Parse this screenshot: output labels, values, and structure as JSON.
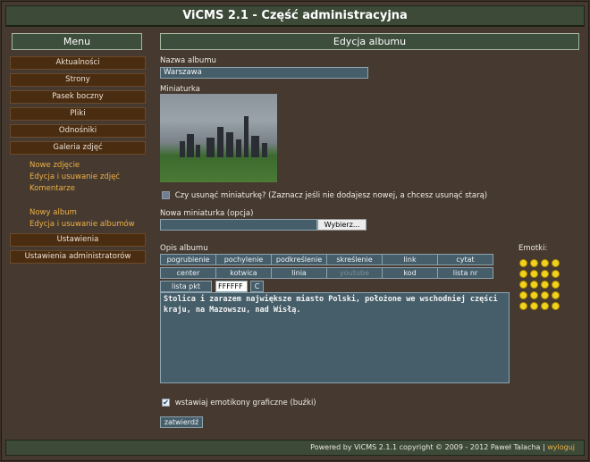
{
  "header": {
    "title": "ViCMS 2.1 - Część administracyjna"
  },
  "sidebar": {
    "title": "Menu",
    "top_items": [
      "Aktualności",
      "Strony",
      "Pasek boczny",
      "Pliki",
      "Odnośniki",
      "Galeria zdjęć"
    ],
    "gallery_links": [
      "Nowe zdjęcie",
      "Edycja i usuwanie zdjęć",
      "Komentarze"
    ],
    "album_links": [
      "Nowy album",
      "Edycja i usuwanie albumów"
    ],
    "bottom_items": [
      "Ustawienia",
      "Ustawienia administratorów"
    ]
  },
  "main": {
    "title": "Edycja albumu",
    "album_name_label": "Nazwa albumu",
    "album_name_value": "Warszawa",
    "thumbnail_label": "Miniaturka",
    "delete_thumb_label": "Czy usunąć miniaturkę? (Zaznacz jeśli nie dodajesz nowej, a chcesz usunąć starą)",
    "new_thumb_label": "Nowa miniaturka (opcja)",
    "browse_label": "Wybierz...",
    "description_label": "Opis albumu",
    "toolbar": {
      "row1": [
        "pogrubienie",
        "pochylenie",
        "podkreślenie",
        "skreślenie",
        "link",
        "cytat"
      ],
      "row2": [
        "center",
        "kotwica",
        "linia",
        "youtube",
        "kod",
        "lista nr"
      ],
      "list_label": "lista pkt",
      "color_value": "FFFFFF",
      "color_button": "C"
    },
    "description_text": "Stolica i zarazem największe miasto Polski, położone we wschodniej części kraju, na Mazowszu, nad Wisłą.",
    "emoticons_label": "Emotki:",
    "insert_emoticons_label": "wstawiaj emotikony graficzne (buźki)",
    "submit_label": "zatwierdź"
  },
  "footer": {
    "text": "Powered by ViCMS 2.1.1 copyright © 2009 - 2012 Paweł Talacha |",
    "logout": "wyloguj"
  },
  "colors": {
    "accent_green": "#3e4e3c",
    "menu_brown": "#4a2c10",
    "link_orange": "#f0b044",
    "field_blue": "#465e6a"
  }
}
